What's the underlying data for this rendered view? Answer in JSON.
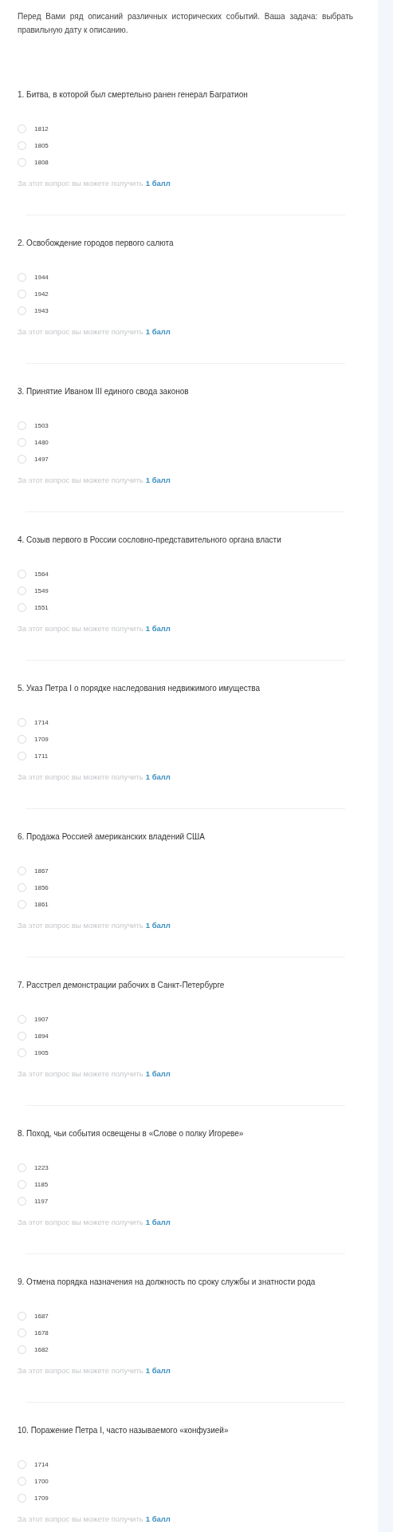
{
  "intro": "Перед Вами ряд описаний различных исторических событий. Ваша задача: выбрать правильную дату к описанию.",
  "questions": [
    {
      "title": "1. Битва, в которой был смертельно ранен генерал Багратион",
      "options": [
        {
          "label": "1812",
          "selected": false
        },
        {
          "label": "1805",
          "selected": false
        },
        {
          "label": "1808",
          "selected": false
        }
      ],
      "score_text": "За этот вопрос вы можете получить",
      "points": "1 балл"
    },
    {
      "title": "2. Освобождение городов первого салюта",
      "options": [
        {
          "label": "1944",
          "selected": false
        },
        {
          "label": "1942",
          "selected": false
        },
        {
          "label": "1943",
          "selected": false
        }
      ],
      "score_text": "За этот вопрос вы можете получить",
      "points": "1 балл"
    },
    {
      "title": "3. Принятие Иваном III единого свода законов",
      "options": [
        {
          "label": "1503",
          "selected": false
        },
        {
          "label": "1480",
          "selected": false
        },
        {
          "label": "1497",
          "selected": false
        }
      ],
      "score_text": "За этот вопрос вы можете получить",
      "points": "1 балл"
    },
    {
      "title": "4. Созыв первого в России сословно-представительного органа власти",
      "options": [
        {
          "label": "1564",
          "selected": false
        },
        {
          "label": "1549",
          "selected": false
        },
        {
          "label": "1551",
          "selected": false
        }
      ],
      "score_text": "За этот вопрос вы можете получить",
      "points": "1 балл"
    },
    {
      "title": "5. Указ Петра I о порядке наследования недвижимого имущества",
      "options": [
        {
          "label": "1714",
          "selected": false
        },
        {
          "label": "1709",
          "selected": false
        },
        {
          "label": "1711",
          "selected": false
        }
      ],
      "score_text": "За этот вопрос вы можете получить",
      "points": "1 балл"
    },
    {
      "title": "6. Продажа Россией американских владений США",
      "options": [
        {
          "label": "1867",
          "selected": false
        },
        {
          "label": "1856",
          "selected": false
        },
        {
          "label": "1861",
          "selected": false
        }
      ],
      "score_text": "За этот вопрос вы можете получить",
      "points": "1 балл"
    },
    {
      "title": "7. Расстрел демонстрации рабочих в Санкт-Петербурге",
      "options": [
        {
          "label": "1907",
          "selected": false
        },
        {
          "label": "1894",
          "selected": false
        },
        {
          "label": "1905",
          "selected": false
        }
      ],
      "score_text": "За этот вопрос вы можете получить",
      "points": "1 балл"
    },
    {
      "title": "8. Поход, чьи события освещены в «Слове о полку Игореве»",
      "options": [
        {
          "label": "1223",
          "selected": false
        },
        {
          "label": "1185",
          "selected": false
        },
        {
          "label": "1197",
          "selected": false
        }
      ],
      "score_text": "За этот вопрос вы можете получить",
      "points": "1 балл"
    },
    {
      "title": "9. Отмена порядка назначения на должность по сроку службы и знатности рода",
      "options": [
        {
          "label": "1687",
          "selected": false
        },
        {
          "label": "1678",
          "selected": false
        },
        {
          "label": "1682",
          "selected": false
        }
      ],
      "score_text": "За этот вопрос вы можете получить",
      "points": "1 балл"
    },
    {
      "title": "10. Поражение Петра I, часто называемого «конфузией»",
      "options": [
        {
          "label": "1714",
          "selected": false
        },
        {
          "label": "1700",
          "selected": false
        },
        {
          "label": "1709",
          "selected": false
        }
      ],
      "score_text": "За этот вопрос вы можете получить",
      "points": "1 балл"
    }
  ]
}
